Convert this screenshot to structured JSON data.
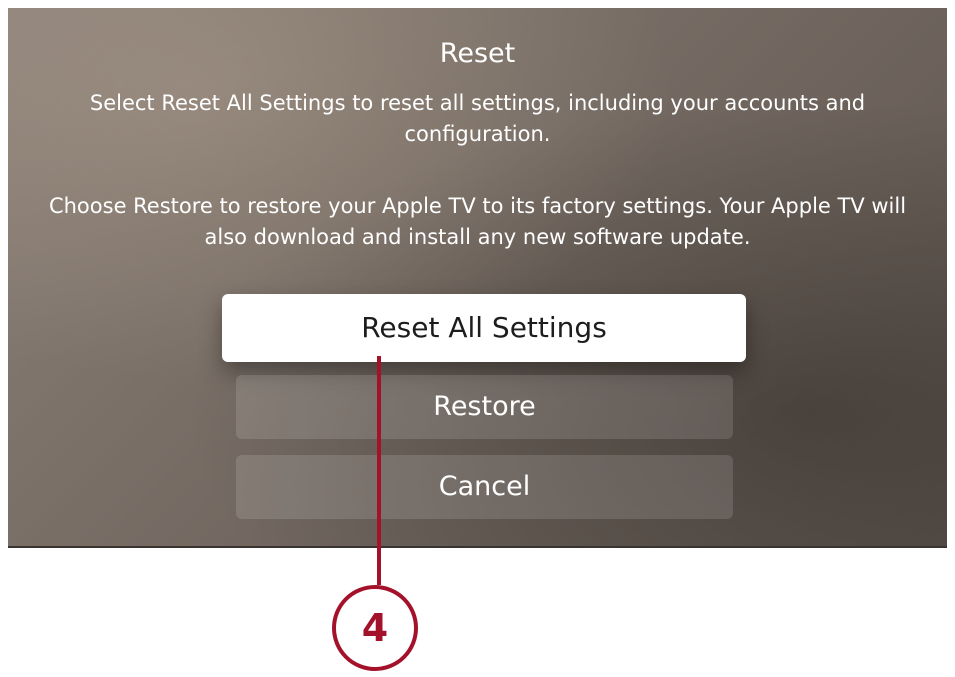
{
  "dialog": {
    "title": "Reset",
    "description_1": "Select Reset All Settings to reset all settings, including your accounts and configuration.",
    "description_2": "Choose Restore to restore your Apple TV to its factory settings. Your Apple TV will also download and install any new software update."
  },
  "buttons": {
    "reset_all_settings": "Reset All Settings",
    "restore": "Restore",
    "cancel": "Cancel"
  },
  "callout": {
    "number": "4",
    "color": "#a3122a"
  }
}
